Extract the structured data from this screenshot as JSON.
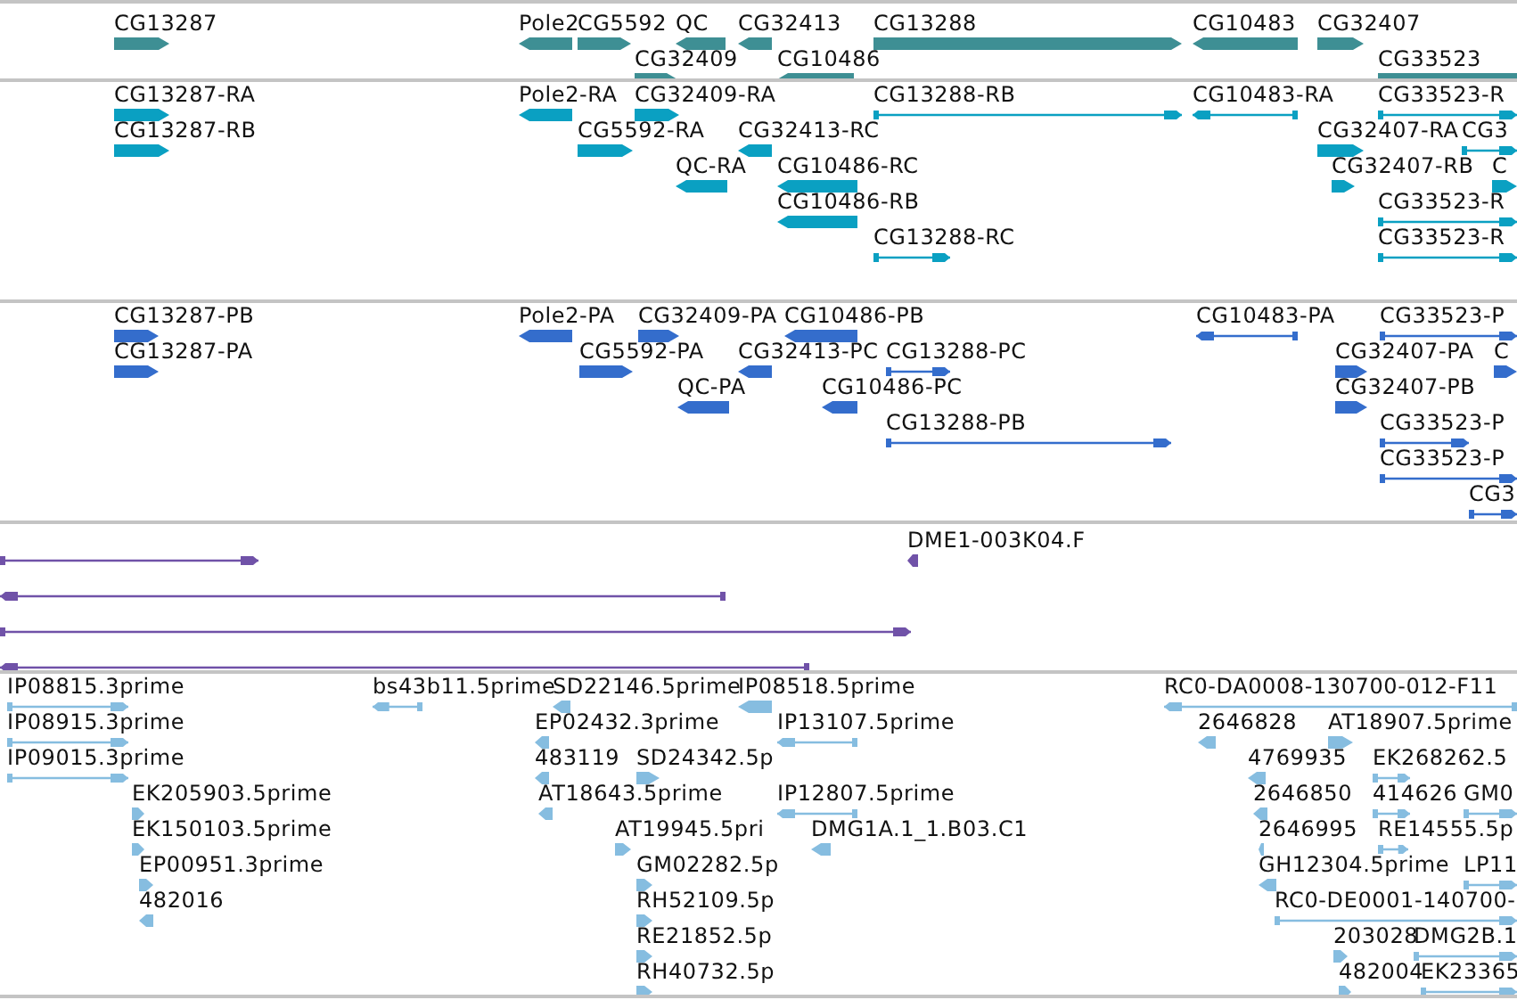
{
  "tracks": [
    {
      "kind": "gene",
      "features": [
        {
          "label": "CG13287",
          "reverse": false
        },
        {
          "label": "Pole2",
          "reverse": true
        },
        {
          "label": "CG5592",
          "reverse": false
        },
        {
          "label": "QC",
          "reverse": true
        },
        {
          "label": "CG32413",
          "reverse": true
        },
        {
          "label": "CG13288",
          "reverse": false
        },
        {
          "label": "CG10483",
          "reverse": true
        },
        {
          "label": "CG32407",
          "reverse": false
        },
        {
          "label": "CG32409",
          "reverse": false
        },
        {
          "label": "CG10486",
          "reverse": true
        },
        {
          "label": "CG33523",
          "reverse": false
        }
      ]
    },
    {
      "kind": "transcript",
      "features": [
        {
          "label": "CG13287-RA",
          "reverse": false
        },
        {
          "label": "Pole2-RA",
          "reverse": true
        },
        {
          "label": "CG32409-RA",
          "reverse": false
        },
        {
          "label": "CG13288-RB",
          "reverse": false
        },
        {
          "label": "CG10483-RA",
          "reverse": true
        },
        {
          "label": "CG33523-R",
          "reverse": false
        },
        {
          "label": "CG13287-RB",
          "reverse": false
        },
        {
          "label": "CG5592-RA",
          "reverse": false
        },
        {
          "label": "CG32413-RC",
          "reverse": true
        },
        {
          "label": "CG32407-RA",
          "reverse": false
        },
        {
          "label": "CG3",
          "reverse": false
        },
        {
          "label": "QC-RA",
          "reverse": true
        },
        {
          "label": "CG10486-RC",
          "reverse": true
        },
        {
          "label": "CG32407-RB",
          "reverse": false
        },
        {
          "label": "C",
          "reverse": false
        },
        {
          "label": "CG10486-RB",
          "reverse": true
        },
        {
          "label": "CG33523-R",
          "reverse": false
        },
        {
          "label": "CG13288-RC",
          "reverse": false
        },
        {
          "label": "CG33523-R",
          "reverse": false
        }
      ]
    },
    {
      "kind": "protein",
      "features": [
        {
          "label": "CG13287-PB",
          "reverse": false
        },
        {
          "label": "Pole2-PA",
          "reverse": true
        },
        {
          "label": "CG32409-PA",
          "reverse": false
        },
        {
          "label": "CG10486-PB",
          "reverse": true
        },
        {
          "label": "CG10483-PA",
          "reverse": true
        },
        {
          "label": "CG33523-P",
          "reverse": false
        },
        {
          "label": "CG13287-PA",
          "reverse": false
        },
        {
          "label": "CG5592-PA",
          "reverse": false
        },
        {
          "label": "CG32413-PC",
          "reverse": true
        },
        {
          "label": "CG13288-PC",
          "reverse": false
        },
        {
          "label": "CG32407-PA",
          "reverse": false
        },
        {
          "label": "C",
          "reverse": false
        },
        {
          "label": "QC-PA",
          "reverse": true
        },
        {
          "label": "CG10486-PC",
          "reverse": true
        },
        {
          "label": "CG32407-PB",
          "reverse": false
        },
        {
          "label": "CG13288-PB",
          "reverse": false
        },
        {
          "label": "CG33523-P",
          "reverse": false
        },
        {
          "label": "CG33523-P",
          "reverse": false
        },
        {
          "label": "CG3",
          "reverse": false
        }
      ]
    },
    {
      "kind": "clone",
      "features": [
        {
          "reverse": false
        },
        {
          "label": "DME1-003K04.F",
          "reverse": true
        },
        {
          "reverse": true
        },
        {
          "reverse": false
        },
        {
          "reverse": true
        }
      ]
    },
    {
      "kind": "est",
      "features": [
        {
          "label": "IP08815.3prime",
          "reverse": false
        },
        {
          "label": "bs43b11.5prime",
          "reverse": true
        },
        {
          "label": "SD22146.5prime",
          "reverse": true
        },
        {
          "label": "IP08518.5prime",
          "reverse": true
        },
        {
          "label": "RC0-DA0008-130700-012-F11",
          "reverse": true
        },
        {
          "label": "IP08915.3prime",
          "reverse": false
        },
        {
          "label": "EP02432.3prime",
          "reverse": true
        },
        {
          "label": "IP13107.5prime",
          "reverse": true
        },
        {
          "label": "2646828",
          "reverse": true
        },
        {
          "label": "AT18907.5prime",
          "reverse": false
        },
        {
          "label": "IP09015.3prime",
          "reverse": false
        },
        {
          "label": "483119",
          "reverse": true
        },
        {
          "label": "SD24342.5p",
          "reverse": false
        },
        {
          "label": "4769935",
          "reverse": true
        },
        {
          "label": "EK268262.5",
          "reverse": false
        },
        {
          "label": "EK205903.5prime",
          "reverse": false
        },
        {
          "label": "AT18643.5prime",
          "reverse": true
        },
        {
          "label": "IP12807.5prime",
          "reverse": true
        },
        {
          "label": "2646850",
          "reverse": true
        },
        {
          "label": "414626",
          "reverse": false
        },
        {
          "label": "GM0",
          "reverse": false
        },
        {
          "label": "EK150103.5prime",
          "reverse": false
        },
        {
          "label": "AT19945.5pri",
          "reverse": false
        },
        {
          "label": "DMG1A.1_1.B03.C1",
          "reverse": true
        },
        {
          "label": "2646995",
          "reverse": true
        },
        {
          "label": "RE14555.5p",
          "reverse": false
        },
        {
          "label": "EP00951.3prime",
          "reverse": false
        },
        {
          "label": "GM02282.5p",
          "reverse": false
        },
        {
          "label": "GH12304.5prime",
          "reverse": true
        },
        {
          "label": "LP11",
          "reverse": false
        },
        {
          "label": "482016",
          "reverse": true
        },
        {
          "label": "RH52109.5p",
          "reverse": false
        },
        {
          "label": "RC0-DE0001-140700-",
          "reverse": false
        },
        {
          "label": "RE21852.5p",
          "reverse": false
        },
        {
          "label": "203028",
          "reverse": false
        },
        {
          "label": "DMG2B.1",
          "reverse": false
        },
        {
          "label": "RH40732.5p",
          "reverse": false
        },
        {
          "label": "482004",
          "reverse": false
        },
        {
          "label": "EK23365",
          "reverse": false
        }
      ]
    }
  ]
}
